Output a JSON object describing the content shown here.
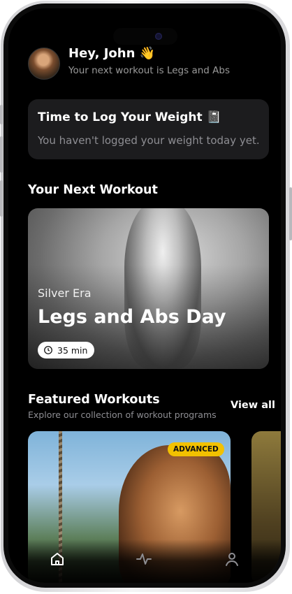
{
  "header": {
    "greeting": "Hey, John 👋",
    "subtitle": "Your next workout is Legs and Abs"
  },
  "weight_card": {
    "title": "Time to Log Your Weight 📓",
    "message": "You haven't logged your weight today yet."
  },
  "next_workout": {
    "section_title": "Your Next Workout",
    "tag": "Silver Era",
    "title": "Legs and Abs Day",
    "duration": "35 min"
  },
  "featured": {
    "section_title": "Featured Workouts",
    "subtitle": "Explore our collection of workout programs",
    "view_all": "View all",
    "cards": [
      {
        "badge": "ADVANCED"
      }
    ]
  },
  "tabbar": {
    "items": [
      {
        "icon": "home-icon",
        "active": true
      },
      {
        "icon": "activity-icon",
        "active": false
      },
      {
        "icon": "profile-icon",
        "active": false
      }
    ]
  },
  "colors": {
    "background": "#000000",
    "card": "#1c1c1e",
    "badge": "#f2c100",
    "muted_text": "#8e8e93"
  }
}
